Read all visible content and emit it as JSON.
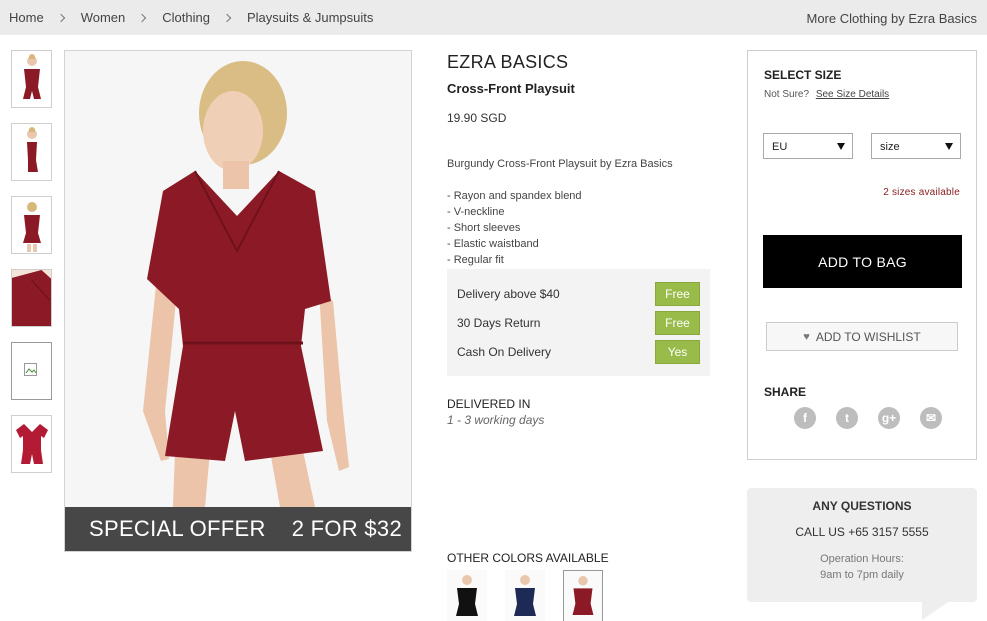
{
  "breadcrumb": {
    "items": [
      "Home",
      "Women",
      "Clothing",
      "Playsuits & Jumpsuits"
    ]
  },
  "more_link": "More Clothing by Ezra Basics",
  "product": {
    "brand": "EZRA BASICS",
    "name": "Cross-Front Playsuit",
    "price": "19.90 SGD",
    "description": "Burgundy Cross-Front Playsuit by Ezra Basics",
    "features": [
      "- Rayon and spandex blend",
      "- V-neckline",
      "- Short sleeves",
      "- Elastic waistband",
      "- Regular fit"
    ],
    "color": "#8b1a26"
  },
  "offer": {
    "left": "SPECIAL OFFER",
    "right": "2 FOR $32"
  },
  "perks": [
    {
      "label": "Delivery above $40",
      "tag": "Free"
    },
    {
      "label": "30 Days Return",
      "tag": "Free"
    },
    {
      "label": "Cash On Delivery",
      "tag": "Yes"
    }
  ],
  "delivery": {
    "title": "DELIVERED IN",
    "sub": "1 - 3 working days"
  },
  "other_colors": {
    "title": "OTHER COLORS AVAILABLE",
    "colors": [
      "#111111",
      "#1c2a55",
      "#8b1a26"
    ]
  },
  "size_panel": {
    "title": "SELECT SIZE",
    "not_sure": "Not Sure?",
    "size_link": "See Size Details",
    "region_select": "EU",
    "size_select": "size",
    "available": "2 sizes available",
    "add_to_bag": "ADD TO BAG",
    "wishlist": "ADD TO WISHLIST",
    "share": "SHARE",
    "socials": [
      {
        "icon": "facebook-icon",
        "glyph": "f"
      },
      {
        "icon": "twitter-icon",
        "glyph": "t"
      },
      {
        "icon": "google-plus-icon",
        "glyph": "g+"
      },
      {
        "icon": "email-icon",
        "glyph": "✉"
      }
    ]
  },
  "questions": {
    "title": "ANY QUESTIONS",
    "call": "CALL US +65 3157 5555",
    "hours_label": "Operation Hours:",
    "hours": "9am to 7pm daily"
  }
}
